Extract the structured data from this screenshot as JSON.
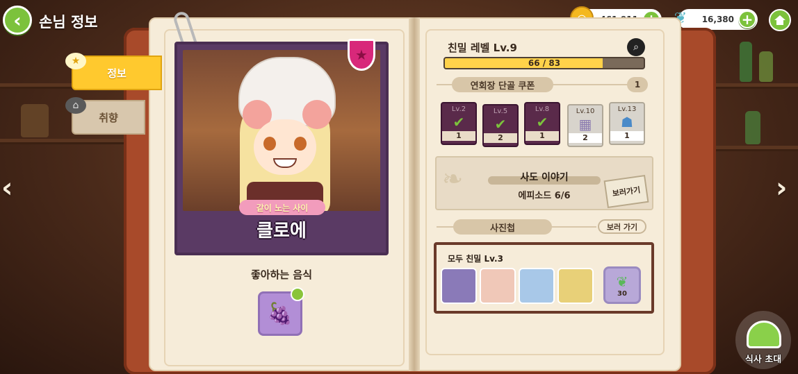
{
  "header": {
    "title": "손님 정보",
    "coins": "461,911",
    "gems": "16,380"
  },
  "tabs": [
    {
      "label": "정보",
      "active": true
    },
    {
      "label": "취향",
      "active": false
    }
  ],
  "character": {
    "relation": "같이 노는 사이",
    "name": "클로에"
  },
  "favorite": {
    "label": "좋아하는 음식"
  },
  "affinity": {
    "title": "친밀 레벨 Lv.9",
    "progress_text": "66 / 83",
    "progress_fraction": 0.795
  },
  "coupon": {
    "label": "연회장 단골 쿠폰",
    "count": "1",
    "rewards": [
      {
        "level": "Lv.2",
        "count": "1",
        "claimed": true
      },
      {
        "level": "Lv.5",
        "count": "2",
        "claimed": true
      },
      {
        "level": "Lv.8",
        "count": "1",
        "claimed": true
      },
      {
        "level": "Lv.10",
        "count": "2",
        "claimed": false
      },
      {
        "level": "Lv.13",
        "count": "1",
        "claimed": false
      }
    ]
  },
  "story": {
    "title": "사도 이야기",
    "episode": "에피소드 6/6",
    "button": "보러가기"
  },
  "album": {
    "label": "사진첩",
    "go_button": "보러 가기",
    "subtitle": "모두 친밀 Lv.3",
    "reward_count": "30"
  },
  "invite": {
    "label": "식사 초대"
  },
  "colors": {
    "accent_green": "#7cc23c",
    "tab_active": "#ffc92e",
    "book_cover": "#a84a2a"
  }
}
